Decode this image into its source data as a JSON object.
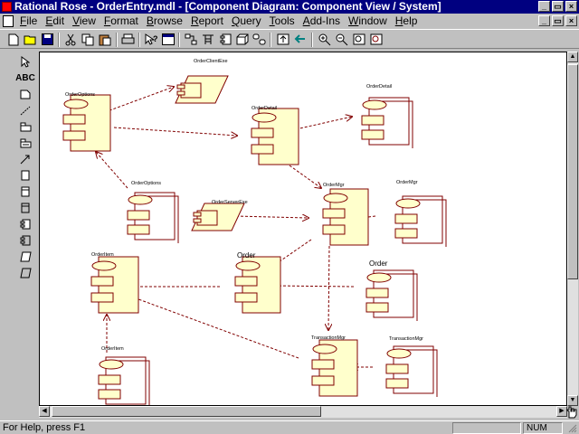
{
  "window": {
    "title": "Rational Rose - OrderEntry.mdl - [Component Diagram: Component View / System]"
  },
  "menu": {
    "items": [
      {
        "label": "File",
        "accel": "F",
        "rest": "ile"
      },
      {
        "label": "Edit",
        "accel": "E",
        "rest": "dit"
      },
      {
        "label": "View",
        "accel": "V",
        "rest": "iew"
      },
      {
        "label": "Format",
        "accel": "F",
        "rest": "ormat"
      },
      {
        "label": "Browse",
        "accel": "B",
        "rest": "rowse"
      },
      {
        "label": "Report",
        "accel": "R",
        "rest": "eport"
      },
      {
        "label": "Query",
        "accel": "Q",
        "rest": "uery"
      },
      {
        "label": "Tools",
        "accel": "T",
        "rest": "ools"
      },
      {
        "label": "Add-Ins",
        "accel": "A",
        "rest": "dd-Ins"
      },
      {
        "label": "Window",
        "accel": "W",
        "rest": "indow"
      },
      {
        "label": "Help",
        "accel": "H",
        "rest": "elp"
      }
    ]
  },
  "toolbar": {
    "buttons": [
      "new-icon",
      "open-icon",
      "save-icon",
      "cut-icon",
      "copy-icon",
      "paste-icon",
      "print-icon",
      "context-help-icon",
      "view-doc-icon",
      "browse-class-icon",
      "browse-interaction-icon",
      "browse-component-icon",
      "browse-deployment-icon",
      "browse-state-icon",
      "browse-parent-icon",
      "browse-previous-icon",
      "zoom-in-icon",
      "zoom-out-icon",
      "fit-window-icon",
      "undo-fit-icon"
    ]
  },
  "palette": {
    "text_tool_label": "ABC"
  },
  "diagram": {
    "components": [
      {
        "id": "c1",
        "label": "OrderClientExe"
      },
      {
        "id": "c2",
        "label": "OrderOptions"
      },
      {
        "id": "c3",
        "label": "OrderDetail"
      },
      {
        "id": "c4",
        "label": "OrderDetail"
      },
      {
        "id": "c5",
        "label": "OrderOptions"
      },
      {
        "id": "c6",
        "label": "OrderServerExe"
      },
      {
        "id": "c7",
        "label": "OrderMgr"
      },
      {
        "id": "c8",
        "label": "OrderMgr"
      },
      {
        "id": "c9",
        "label": "OrderItem"
      },
      {
        "id": "c10",
        "label": "Order"
      },
      {
        "id": "c11",
        "label": "Order"
      },
      {
        "id": "c12",
        "label": "OrderItem"
      },
      {
        "id": "c13",
        "label": "TransactionMgr"
      },
      {
        "id": "c14",
        "label": "TransactionMgr"
      }
    ],
    "colors": {
      "package_fill": "#ffffcc",
      "outline": "#800000",
      "dependency": "#800000"
    }
  },
  "status": {
    "help_text": "For Help, press F1",
    "num_indicator": "NUM"
  }
}
